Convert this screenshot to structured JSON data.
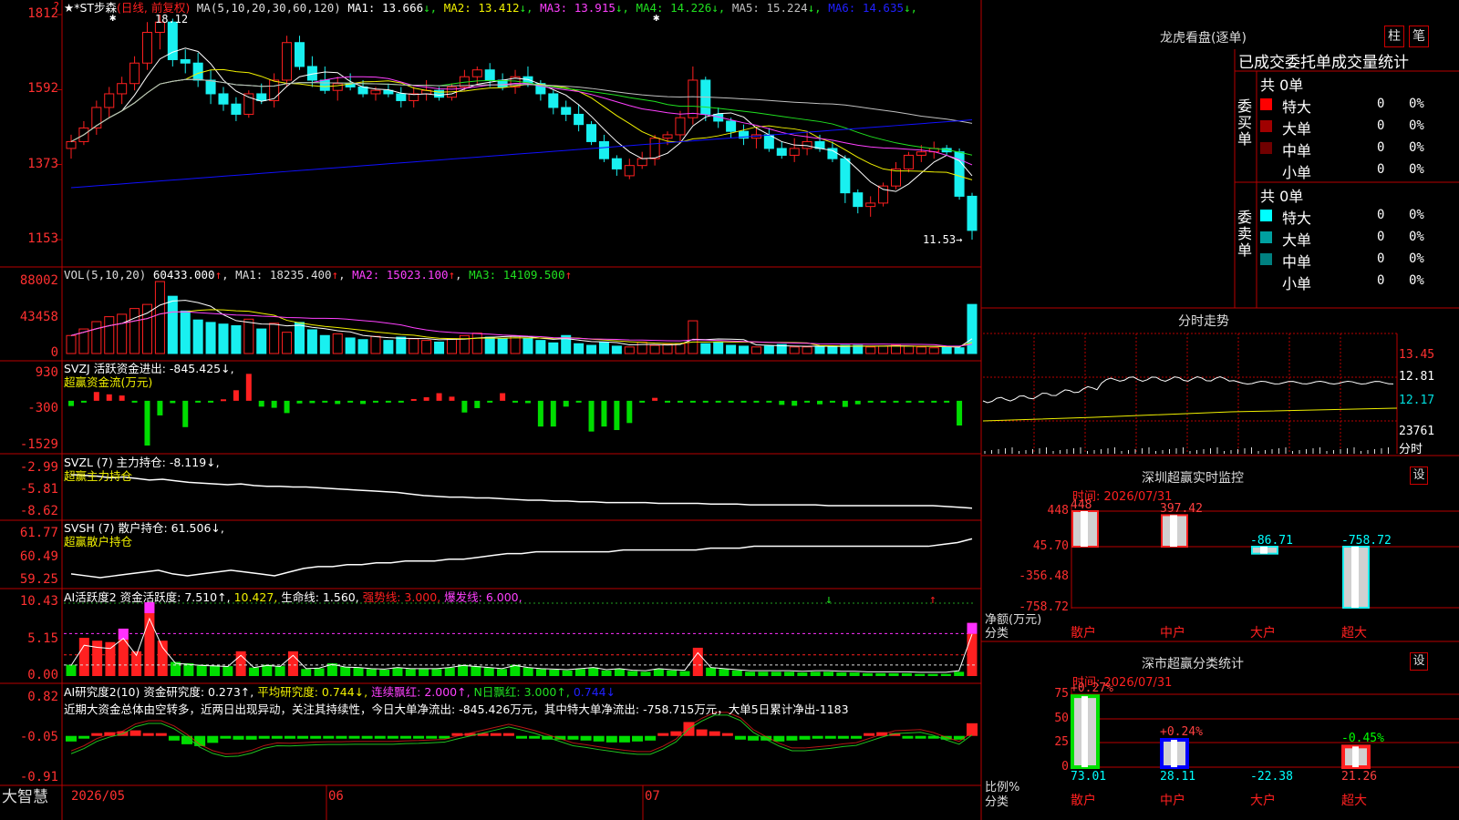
{
  "colors": {
    "up": "#ff2020",
    "down": "#19f0f0",
    "grid": "#b80000",
    "ma1": "#ffffff",
    "ma2": "#f0f000",
    "ma3": "#ff40ff",
    "ma4": "#20e020",
    "ma5": "#c0c0c0",
    "ma6": "#1010ff",
    "money_green": "#00dd00",
    "pink": "#ff30ff"
  },
  "main": {
    "header": {
      "name": "★*ST步森",
      "period": "(日线, 前复权)",
      "ma_def": "MA(5,10,20,30,60,120)",
      "items": [
        {
          "label": "MA1:",
          "value": "13.666",
          "arrow": "↓",
          "color": "#ffffff"
        },
        {
          "label": "MA2:",
          "value": "13.412",
          "arrow": "↓",
          "color": "#f0f000"
        },
        {
          "label": "MA3:",
          "value": "13.915",
          "arrow": "↓",
          "color": "#ff40ff"
        },
        {
          "label": "MA4:",
          "value": "14.226",
          "arrow": "↓",
          "color": "#20e020"
        },
        {
          "label": "MA5:",
          "value": "15.224",
          "arrow": "↓",
          "color": "#c0c0c0"
        },
        {
          "label": "MA6:",
          "value": "14.635",
          "arrow": "↓",
          "color": "#2020ff"
        }
      ]
    },
    "axis_labels": [
      "1812",
      "1592",
      "1373",
      "1153"
    ],
    "axis_values": [
      18.12,
      15.92,
      13.73,
      11.53
    ],
    "high_marker": "18.12",
    "low_marker": "11.53→"
  },
  "vol": {
    "header": "VOL(5,10,20)",
    "value": "60433.000",
    "ma1": "18235.400",
    "ma2": "15023.100",
    "ma3": "14109.500",
    "arrow": "↑",
    "axis_labels": [
      "88002",
      "43458",
      "0"
    ]
  },
  "svzj": {
    "header": "SVZJ  活跃资金进出: -845.425↓,",
    "sub": "超赢资金流(万元)",
    "axis_labels": [
      "930",
      "-300",
      "-1529"
    ]
  },
  "svzl": {
    "header": "SVZL (7) 主力持仓: -8.119↓,",
    "sub": "超赢主力持仓",
    "axis_labels": [
      "-2.99",
      "-5.81",
      "-8.62"
    ]
  },
  "svsh": {
    "header": "SVSH (7) 散户持仓: 61.506↓,",
    "sub": "超赢散户持仓",
    "axis_labels": [
      "61.77",
      "60.49",
      "59.25"
    ]
  },
  "ai1": {
    "header": "AI活跃度2 资金活跃度: 7.510↑,",
    "v2": "10.427,",
    "life": "生命线: 1.560,",
    "strong": "强势线: 3.000,",
    "burst": "爆发线: 6.000,",
    "axis_labels": [
      "10.43",
      "5.15",
      "0.00"
    ]
  },
  "ai2": {
    "header": "AI研究度2(10) 资金研究度: 0.273↑,",
    "avg": "平均研究度: 0.744↓,",
    "lianxu": "连续飘红: 2.000↑,",
    "nday": "N日飘红: 3.000↑,",
    "last": "0.744↓",
    "note": "近期大资金总体由空转多，近两日出现异动，关注其持续性，今日大单净流出: -845.426万元，其中特大单净流出: -758.715万元，大单5日累计净出-1183",
    "axis_labels": [
      "0.82",
      "-0.05",
      "-0.91"
    ]
  },
  "time_axis": {
    "labels": [
      "2026/05",
      "06",
      "07"
    ],
    "logo": "大智慧"
  },
  "right": {
    "lhb_title": "龙虎看盘(逐单)",
    "btn_zhu": "柱",
    "btn_bi": "笔",
    "stats_title": "已成交委托单成交量统计",
    "buy_label": "委买单",
    "sell_label": "委卖单",
    "buy_total": "共 0单",
    "sell_total": "共 0单",
    "buy_rows": [
      {
        "name": "特大",
        "color": "#ff0000",
        "count": "0",
        "pct": "0%"
      },
      {
        "name": "大单",
        "color": "#a00000",
        "count": "0",
        "pct": "0%"
      },
      {
        "name": "中单",
        "color": "#700000",
        "count": "0",
        "pct": "0%"
      },
      {
        "name": "小单",
        "color": "",
        "count": "0",
        "pct": "0%"
      }
    ],
    "sell_rows": [
      {
        "name": "特大",
        "color": "#00ffff",
        "count": "0",
        "pct": "0%"
      },
      {
        "name": "大单",
        "color": "#00a0a0",
        "count": "0",
        "pct": "0%"
      },
      {
        "name": "中单",
        "color": "#008080",
        "count": "0",
        "pct": "0%"
      },
      {
        "name": "小单",
        "color": "",
        "count": "0",
        "pct": "0%"
      }
    ],
    "fs_title": "分时走势",
    "fs_axis": [
      "13.45",
      "12.81",
      "12.17"
    ],
    "fs_vol": "23761",
    "fs_vol_label": "分时",
    "mon_title": "深圳超赢实时监控",
    "mon_setting": "设",
    "mon_time": "时间: 2026/07/31",
    "mon_axis": [
      "448",
      "45.70",
      "-356.48",
      "-758.72"
    ],
    "mon_ylabel": "净额(万元)",
    "mon_xlabel": "分类",
    "mon_bars": [
      {
        "name": "散户",
        "label": "448",
        "value": 448,
        "label_color": "#ff4040"
      },
      {
        "name": "中户",
        "label": "397.42",
        "value": 397.42,
        "label_color": "#ff4040"
      },
      {
        "name": "大户",
        "label": "-86.71",
        "value": -86.71,
        "label_color": "#00ffff"
      },
      {
        "name": "超大",
        "label": "-758.72",
        "value": -758.72,
        "label_color": "#00ffff"
      }
    ],
    "cls_title": "深市超赢分类统计",
    "cls_setting": "设",
    "cls_time": "时间: 2026/07/31",
    "cls_axis": [
      "75",
      "50",
      "25",
      "0"
    ],
    "cls_ylabel": "比例%",
    "cls_xlabel": "分类",
    "cls_bars": [
      {
        "name": "散户",
        "pct": "+0.27%",
        "value": "73.01",
        "height": 73.01,
        "fill": "#00e000",
        "value_color": "#00ffff",
        "pct_color": "#ff4040"
      },
      {
        "name": "中户",
        "pct": "+0.24%",
        "value": "28.11",
        "height": 28.11,
        "fill": "#0000ff",
        "value_color": "#00ffff",
        "pct_color": "#ff4040"
      },
      {
        "name": "大户",
        "pct": "",
        "value": "-22.38",
        "height": 0,
        "fill": "",
        "value_color": "#00ffff",
        "pct_color": "#00ff00"
      },
      {
        "name": "超大",
        "pct": "-0.45%",
        "value": "21.26",
        "height": 21.26,
        "fill": "#ff2020",
        "value_color": "#ff4040",
        "pct_color": "#00ff00"
      }
    ]
  },
  "chart_data": [
    {
      "type": "candlestick",
      "title": "★*ST步森 (日线, 前复权)",
      "ylim": [
        11.53,
        18.12
      ],
      "ohlc": [
        [
          14.2,
          14.6,
          13.9,
          14.4
        ],
        [
          14.4,
          15.0,
          14.3,
          14.8
        ],
        [
          14.8,
          15.6,
          14.6,
          15.4
        ],
        [
          15.4,
          16.0,
          15.1,
          15.8
        ],
        [
          15.8,
          16.3,
          15.5,
          16.1
        ],
        [
          16.1,
          16.9,
          15.9,
          16.7
        ],
        [
          16.7,
          17.9,
          16.5,
          17.6
        ],
        [
          17.6,
          18.12,
          17.1,
          17.9
        ],
        [
          17.9,
          18.0,
          16.6,
          16.8
        ],
        [
          16.8,
          17.1,
          16.4,
          16.7
        ],
        [
          16.7,
          17.0,
          16.0,
          16.2
        ],
        [
          16.2,
          16.5,
          15.5,
          15.8
        ],
        [
          15.8,
          16.0,
          15.3,
          15.5
        ],
        [
          15.5,
          15.7,
          15.0,
          15.2
        ],
        [
          15.2,
          15.9,
          15.1,
          15.8
        ],
        [
          15.8,
          16.1,
          15.5,
          15.6
        ],
        [
          15.6,
          16.4,
          15.4,
          16.2
        ],
        [
          16.2,
          17.5,
          16.0,
          17.3
        ],
        [
          17.3,
          17.5,
          16.5,
          16.6
        ],
        [
          16.6,
          16.9,
          16.0,
          16.2
        ],
        [
          16.2,
          16.6,
          15.8,
          15.9
        ],
        [
          15.9,
          16.3,
          15.6,
          16.1
        ],
        [
          16.1,
          16.4,
          15.9,
          16.0
        ],
        [
          16.0,
          16.2,
          15.7,
          15.8
        ],
        [
          15.8,
          16.0,
          15.6,
          15.9
        ],
        [
          15.9,
          16.1,
          15.7,
          15.8
        ],
        [
          15.8,
          16.0,
          15.4,
          15.6
        ],
        [
          15.6,
          16.0,
          15.4,
          15.8
        ],
        [
          15.8,
          16.2,
          15.6,
          15.9
        ],
        [
          15.9,
          16.0,
          15.6,
          15.7
        ],
        [
          15.7,
          16.1,
          15.6,
          16.0
        ],
        [
          16.0,
          16.5,
          15.9,
          16.3
        ],
        [
          16.3,
          16.6,
          16.1,
          16.5
        ],
        [
          16.5,
          16.7,
          16.0,
          16.2
        ],
        [
          16.2,
          16.4,
          15.9,
          16.0
        ],
        [
          16.0,
          16.5,
          15.8,
          16.3
        ],
        [
          16.3,
          16.6,
          16.0,
          16.1
        ],
        [
          16.1,
          16.2,
          15.6,
          15.8
        ],
        [
          15.8,
          15.9,
          15.2,
          15.4
        ],
        [
          15.4,
          15.6,
          15.0,
          15.2
        ],
        [
          15.2,
          15.5,
          14.7,
          14.9
        ],
        [
          14.9,
          15.0,
          14.3,
          14.4
        ],
        [
          14.4,
          14.6,
          13.8,
          13.9
        ],
        [
          13.9,
          14.0,
          13.4,
          13.6
        ],
        [
          13.4,
          13.9,
          13.3,
          13.7
        ],
        [
          13.7,
          14.1,
          13.6,
          13.9
        ],
        [
          13.9,
          14.6,
          13.7,
          14.5
        ],
        [
          14.5,
          14.7,
          14.3,
          14.6
        ],
        [
          14.6,
          15.3,
          14.4,
          15.1
        ],
        [
          15.1,
          16.6,
          14.9,
          16.2
        ],
        [
          16.2,
          16.3,
          15.0,
          15.2
        ],
        [
          15.2,
          15.4,
          14.8,
          15.0
        ],
        [
          15.0,
          15.1,
          14.5,
          14.7
        ],
        [
          14.7,
          14.9,
          14.3,
          14.5
        ],
        [
          14.5,
          14.8,
          14.2,
          14.6
        ],
        [
          14.6,
          14.8,
          14.1,
          14.2
        ],
        [
          14.2,
          14.4,
          13.9,
          14.0
        ],
        [
          14.0,
          14.5,
          13.8,
          14.2
        ],
        [
          14.2,
          14.7,
          14.0,
          14.4
        ],
        [
          14.4,
          14.6,
          14.1,
          14.2
        ],
        [
          14.2,
          14.4,
          13.8,
          13.9
        ],
        [
          13.9,
          14.0,
          12.6,
          12.9
        ],
        [
          12.9,
          13.0,
          12.3,
          12.5
        ],
        [
          12.5,
          12.8,
          12.2,
          12.6
        ],
        [
          12.6,
          13.2,
          12.5,
          13.1
        ],
        [
          13.1,
          13.8,
          13.0,
          13.6
        ],
        [
          13.6,
          14.1,
          13.5,
          14.0
        ],
        [
          14.0,
          14.3,
          13.8,
          14.1
        ],
        [
          14.1,
          14.4,
          13.9,
          14.2
        ],
        [
          14.2,
          14.3,
          14.0,
          14.1
        ],
        [
          14.1,
          14.2,
          12.7,
          12.8
        ],
        [
          12.8,
          12.9,
          11.53,
          11.8
        ]
      ]
    },
    {
      "type": "bar",
      "title": "VOL(5,10,20)",
      "values": [
        22,
        30,
        39,
        45,
        48,
        55,
        60,
        88,
        70,
        52,
        41,
        38,
        36,
        34,
        42,
        30,
        37,
        26,
        38,
        29,
        22,
        24,
        19,
        17,
        21,
        16,
        20,
        18,
        16,
        14,
        18,
        22,
        25,
        20,
        18,
        21,
        19,
        16,
        13,
        22,
        12,
        10,
        14,
        9,
        8,
        14,
        10,
        11,
        12,
        40,
        12,
        14,
        10,
        9,
        8,
        9,
        11,
        8,
        8,
        9,
        8,
        10,
        10,
        8,
        9,
        10,
        9,
        8,
        7,
        8,
        7,
        60
      ],
      "ylim": [
        0,
        88002
      ],
      "scale": "thousands"
    },
    {
      "type": "bar",
      "title": "SVZJ 超赢资金流(万元)",
      "values": [
        -180,
        -60,
        300,
        220,
        180,
        -40,
        -1529,
        -500,
        -80,
        -900,
        -30,
        -30,
        50,
        360,
        920,
        -200,
        -240,
        -420,
        -90,
        -80,
        -60,
        -110,
        -60,
        -110,
        -30,
        -30,
        -40,
        60,
        120,
        260,
        140,
        -400,
        -250,
        -40,
        260,
        -30,
        -80,
        -880,
        -880,
        -200,
        -30,
        -1050,
        -880,
        -1000,
        -760,
        -40,
        100,
        -20,
        -20,
        -20,
        -20,
        -30,
        -20,
        -30,
        -20,
        -30,
        -140,
        -170,
        -20,
        -120,
        -40,
        -210,
        -120,
        -20,
        -30,
        -30,
        -20,
        -40,
        -20,
        -40,
        -845
      ],
      "ylim": [
        -1529,
        930
      ]
    },
    {
      "type": "line",
      "title": "SVZL 主力持仓",
      "ylim": [
        -8.62,
        -2.99
      ],
      "values": [
        -3.8,
        -3.9,
        -4.0,
        -4.2,
        -4.1,
        -4.3,
        -4.5,
        -4.4,
        -4.6,
        -4.8,
        -4.9,
        -5.0,
        -5.1,
        -5.0,
        -5.2,
        -5.3,
        -5.3,
        -5.4,
        -5.4,
        -5.5,
        -5.6,
        -5.7,
        -5.8,
        -5.9,
        -6.0,
        -6.1,
        -6.3,
        -6.5,
        -6.6,
        -6.7,
        -6.7,
        -6.8,
        -6.8,
        -6.9,
        -7.0,
        -7.1,
        -7.1,
        -7.2,
        -7.2,
        -7.3,
        -7.3,
        -7.4,
        -7.4,
        -7.4,
        -7.4,
        -7.5,
        -7.5,
        -7.5,
        -7.5,
        -7.6,
        -7.6,
        -7.6,
        -7.7,
        -7.7,
        -7.7,
        -7.7,
        -7.7,
        -7.7,
        -7.8,
        -7.8,
        -7.8,
        -7.8,
        -7.8,
        -7.8,
        -7.8,
        -7.8,
        -7.8,
        -7.9,
        -8.0,
        -8.119
      ]
    },
    {
      "type": "line",
      "title": "SVSH 散户持仓",
      "ylim": [
        59.25,
        61.77
      ],
      "values": [
        59.6,
        59.5,
        59.4,
        59.5,
        59.6,
        59.7,
        59.8,
        59.6,
        59.5,
        59.6,
        59.7,
        59.8,
        59.7,
        59.6,
        59.5,
        59.7,
        59.9,
        60.0,
        60.0,
        60.1,
        60.1,
        60.2,
        60.2,
        60.3,
        60.3,
        60.3,
        60.4,
        60.4,
        60.5,
        60.6,
        60.7,
        60.7,
        60.8,
        60.8,
        60.8,
        60.8,
        60.8,
        60.8,
        60.9,
        60.9,
        60.9,
        60.9,
        60.9,
        60.9,
        61.0,
        61.0,
        61.0,
        61.1,
        61.1,
        61.1,
        61.1,
        61.1,
        61.1,
        61.1,
        61.1,
        61.1,
        61.1,
        61.1,
        61.1,
        61.1,
        61.2,
        61.3,
        61.506
      ]
    },
    {
      "type": "bar",
      "title": "AI活跃度2 资金活跃度",
      "ylim": [
        0,
        10.43
      ],
      "values": [
        1.6,
        5.4,
        5.0,
        4.8,
        6.7,
        3.5,
        10.43,
        5.0,
        2.0,
        1.8,
        1.6,
        1.5,
        1.4,
        3.5,
        1.2,
        1.6,
        1.4,
        3.5,
        1.0,
        1.1,
        1.8,
        1.3,
        1.2,
        1.0,
        0.9,
        1.2,
        1.0,
        1.0,
        1.0,
        1.2,
        1.6,
        1.4,
        1.2,
        1.0,
        1.6,
        1.2,
        1.0,
        0.9,
        0.8,
        1.0,
        1.2,
        0.8,
        1.0,
        0.7,
        0.6,
        1.0,
        0.8,
        0.7,
        4.0,
        1.2,
        1.0,
        0.8,
        0.6,
        0.6,
        0.6,
        0.6,
        0.5,
        0.6,
        0.6,
        0.5,
        0.5,
        0.4,
        0.4,
        0.4,
        0.4,
        0.3,
        0.3,
        0.3,
        0.6,
        7.51
      ]
    },
    {
      "type": "bar",
      "title": "AI研究度2(10) 资金研究度",
      "ylim": [
        -0.91,
        0.82
      ],
      "values": [
        -0.12,
        -0.05,
        0.06,
        0.08,
        0.1,
        0.12,
        0.06,
        0.06,
        -0.1,
        -0.18,
        -0.22,
        -0.15,
        -0.05,
        -0.08,
        -0.08,
        -0.06,
        -0.06,
        -0.06,
        -0.06,
        -0.06,
        -0.05,
        -0.06,
        -0.05,
        -0.06,
        -0.06,
        -0.05,
        -0.04,
        -0.04,
        -0.04,
        -0.04,
        0.06,
        0.06,
        0.06,
        0.06,
        0.06,
        -0.04,
        -0.05,
        -0.08,
        -0.08,
        -0.08,
        -0.1,
        -0.12,
        -0.14,
        -0.14,
        -0.12,
        -0.1,
        0.06,
        0.1,
        0.3,
        0.14,
        0.1,
        0.06,
        -0.08,
        -0.1,
        -0.1,
        -0.12,
        -0.1,
        -0.08,
        -0.06,
        -0.06,
        -0.06,
        -0.06,
        0.06,
        0.08,
        0.06,
        -0.04,
        -0.04,
        -0.04,
        -0.08,
        -0.08,
        0.273
      ]
    }
  ]
}
